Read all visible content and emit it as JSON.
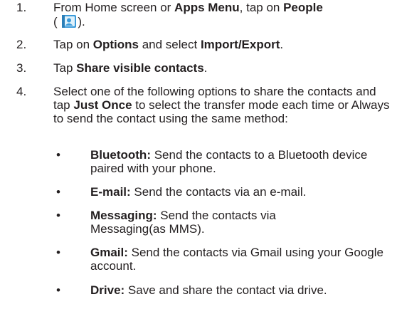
{
  "steps": [
    {
      "num": "1.",
      "line1_a": "From Home screen or ",
      "line1_b": "Apps Menu",
      "line1_c": ", tap on ",
      "line1_d": "People",
      "line2_a": "( ",
      "line2_b": ").",
      "icon": "people-app-icon"
    },
    {
      "num": "2.",
      "a": "Tap on ",
      "b": "Options",
      "c": " and select ",
      "d": "Import/Export",
      "e": "."
    },
    {
      "num": "3.",
      "a": "Tap ",
      "b": "Share visible contacts",
      "c": "."
    },
    {
      "num": "4.",
      "a": "Select one of the following options to share the contacts and tap ",
      "b": "Just Once",
      "c": " to select the transfer mode each time or Always to send the contact using the same method:"
    }
  ],
  "options": [
    {
      "bullet": "•",
      "label": "Bluetooth:",
      "text": " Send the contacts to a Bluetooth device paired with your phone."
    },
    {
      "bullet": "•",
      "label": "E-mail:",
      "text": " Send the contacts via an e-mail."
    },
    {
      "bullet": "•",
      "label": "Messaging:",
      "text": " Send the contacts via Messaging(as MMS)."
    },
    {
      "bullet": "•",
      "label": "Gmail:",
      "text": " Send the contacts via Gmail using your Google account."
    },
    {
      "bullet": "•",
      "label": "Drive:",
      "text": " Save and share the contact via drive."
    }
  ],
  "colors": {
    "text": "#231f20",
    "icon_blue": "#3a9ad9",
    "icon_light": "#dff1fb"
  }
}
